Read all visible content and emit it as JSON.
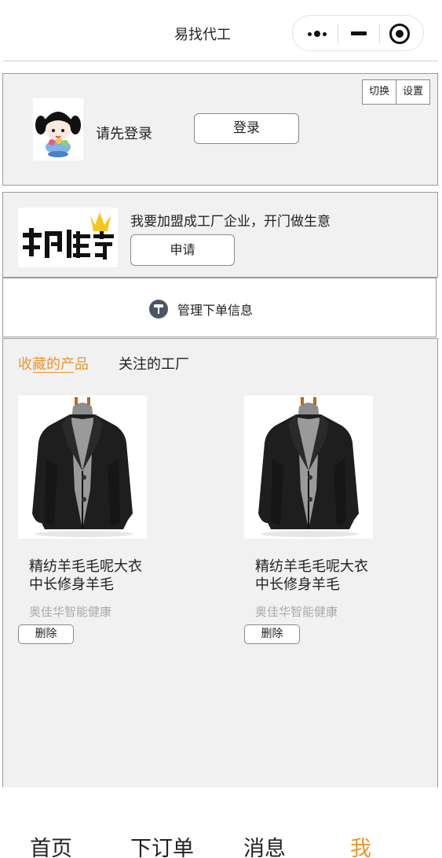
{
  "navbar": {
    "title": "易找代工",
    "capsule": {
      "more_icon": "more-dots-icon",
      "minimize_icon": "minimize-icon",
      "close_icon": "target-close-icon"
    }
  },
  "login_card": {
    "prompt": "请先登录",
    "login_label": "登录",
    "switch_label": "切换",
    "settings_label": "设置"
  },
  "join_card": {
    "text": "我要加盟成工厂企业，开门做生意",
    "apply_label": "申请"
  },
  "manage": {
    "label": "管理下单信息",
    "icon": "pin-icon"
  },
  "favorites": {
    "tabs": [
      {
        "label": "收藏的产品",
        "active": true
      },
      {
        "label": "关注的工厂",
        "active": false
      }
    ],
    "products": [
      {
        "name": "精纺羊毛毛呢大衣中长修身羊毛",
        "shop": "奥佳华智能健康",
        "delete_label": "删除"
      },
      {
        "name": "精纺羊毛毛呢大衣中长修身羊毛",
        "shop": "奥佳华智能健康",
        "delete_label": "删除"
      }
    ]
  },
  "tabbar": {
    "items": [
      {
        "label": "首页",
        "active": false
      },
      {
        "label": "下订单",
        "active": false
      },
      {
        "label": "消息",
        "active": false
      },
      {
        "label": "我",
        "active": true
      }
    ]
  },
  "colors": {
    "accent": "#e9962d",
    "panel_bg": "#f1f1f1",
    "border": "#9a9a9a"
  }
}
